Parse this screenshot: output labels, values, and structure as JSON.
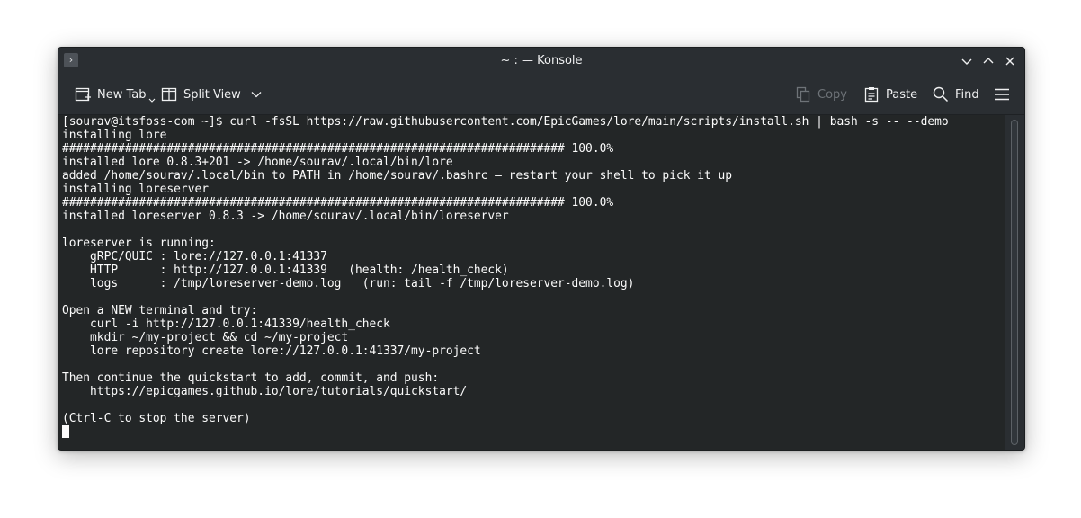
{
  "window": {
    "title": "~ : — Konsole"
  },
  "toolbar": {
    "new_tab_label": "New Tab",
    "split_view_label": "Split View",
    "copy_label": "Copy",
    "paste_label": "Paste",
    "find_label": "Find"
  },
  "icons": {
    "app": "konsole-app-icon",
    "minimize": "chevron-down-icon",
    "maximize": "chevron-up-icon",
    "close": "close-icon",
    "new_tab": "new-tab-icon",
    "split_view": "split-view-icon",
    "copy": "copy-icon",
    "paste": "paste-icon",
    "find": "search-icon",
    "menu": "hamburger-menu-icon"
  },
  "terminal": {
    "lines": [
      "[sourav@itsfoss-com ~]$ curl -fsSL https://raw.githubusercontent.com/EpicGames/lore/main/scripts/install.sh | bash -s -- --demo",
      "installing lore",
      "######################################################################## 100.0%",
      "installed lore 0.8.3+201 -> /home/sourav/.local/bin/lore",
      "added /home/sourav/.local/bin to PATH in /home/sourav/.bashrc — restart your shell to pick it up",
      "installing loreserver",
      "######################################################################## 100.0%",
      "installed loreserver 0.8.3 -> /home/sourav/.local/bin/loreserver",
      "",
      "loreserver is running:",
      "    gRPC/QUIC : lore://127.0.0.1:41337",
      "    HTTP      : http://127.0.0.1:41339   (health: /health_check)",
      "    logs      : /tmp/loreserver-demo.log   (run: tail -f /tmp/loreserver-demo.log)",
      "",
      "Open a NEW terminal and try:",
      "    curl -i http://127.0.0.1:41339/health_check",
      "    mkdir ~/my-project && cd ~/my-project",
      "    lore repository create lore://127.0.0.1:41337/my-project",
      "",
      "Then continue the quickstart to add, commit, and push:",
      "    https://epicgames.github.io/lore/tutorials/quickstart/",
      "",
      "(Ctrl-C to stop the server)"
    ]
  },
  "colors": {
    "window_bg": "#2a2e32",
    "terminal_bg": "#232627",
    "terminal_fg": "#fcfcfc",
    "disabled_fg": "#6e7378"
  }
}
